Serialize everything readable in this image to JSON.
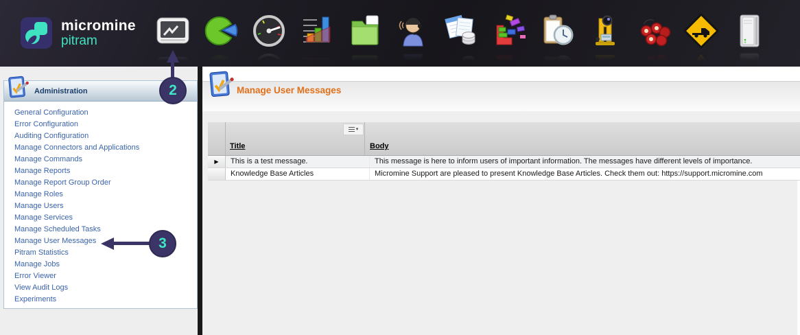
{
  "brand": {
    "line1": "micromine",
    "line2": "pitram"
  },
  "toolbar": {
    "icons": [
      "pitram-monitor",
      "pie-chart",
      "gauge",
      "bar-chart",
      "folder",
      "operator",
      "data-sheets",
      "blocks",
      "clipboard-clock",
      "survey-instrument",
      "dynamite",
      "truck-sign",
      "server"
    ]
  },
  "annotations": [
    {
      "label": "2"
    },
    {
      "label": "3"
    }
  ],
  "sidebar": {
    "header": "Administration",
    "items": [
      "General Configuration",
      "Error Configuration",
      "Auditing Configuration",
      "Manage Connectors and Applications",
      "Manage Commands",
      "Manage Reports",
      "Manage Report Group Order",
      "Manage Roles",
      "Manage Users",
      "Manage Services",
      "Manage Scheduled Tasks",
      "Manage User Messages",
      "Pitram Statistics",
      "Manage Jobs",
      "Error Viewer",
      "View Audit Logs",
      "Experiments"
    ]
  },
  "main": {
    "title": "Manage User Messages",
    "table": {
      "columns": [
        "Title",
        "Body"
      ],
      "rows": [
        {
          "marker": "▶",
          "title": "This is a test message.",
          "body": "This message is here to inform users of important information. The messages have different levels of importance."
        },
        {
          "marker": "",
          "title": "Knowledge Base Articles",
          "body": "Micromine Support are pleased to present Knowledge Base Articles. Check them out: https://support.micromine.com"
        }
      ]
    }
  },
  "colors": {
    "accent_teal": "#3fe3c2",
    "badge_navy": "#3a3566",
    "title_orange": "#e2701a",
    "sidebar_link_blue": "#3a63ab"
  }
}
